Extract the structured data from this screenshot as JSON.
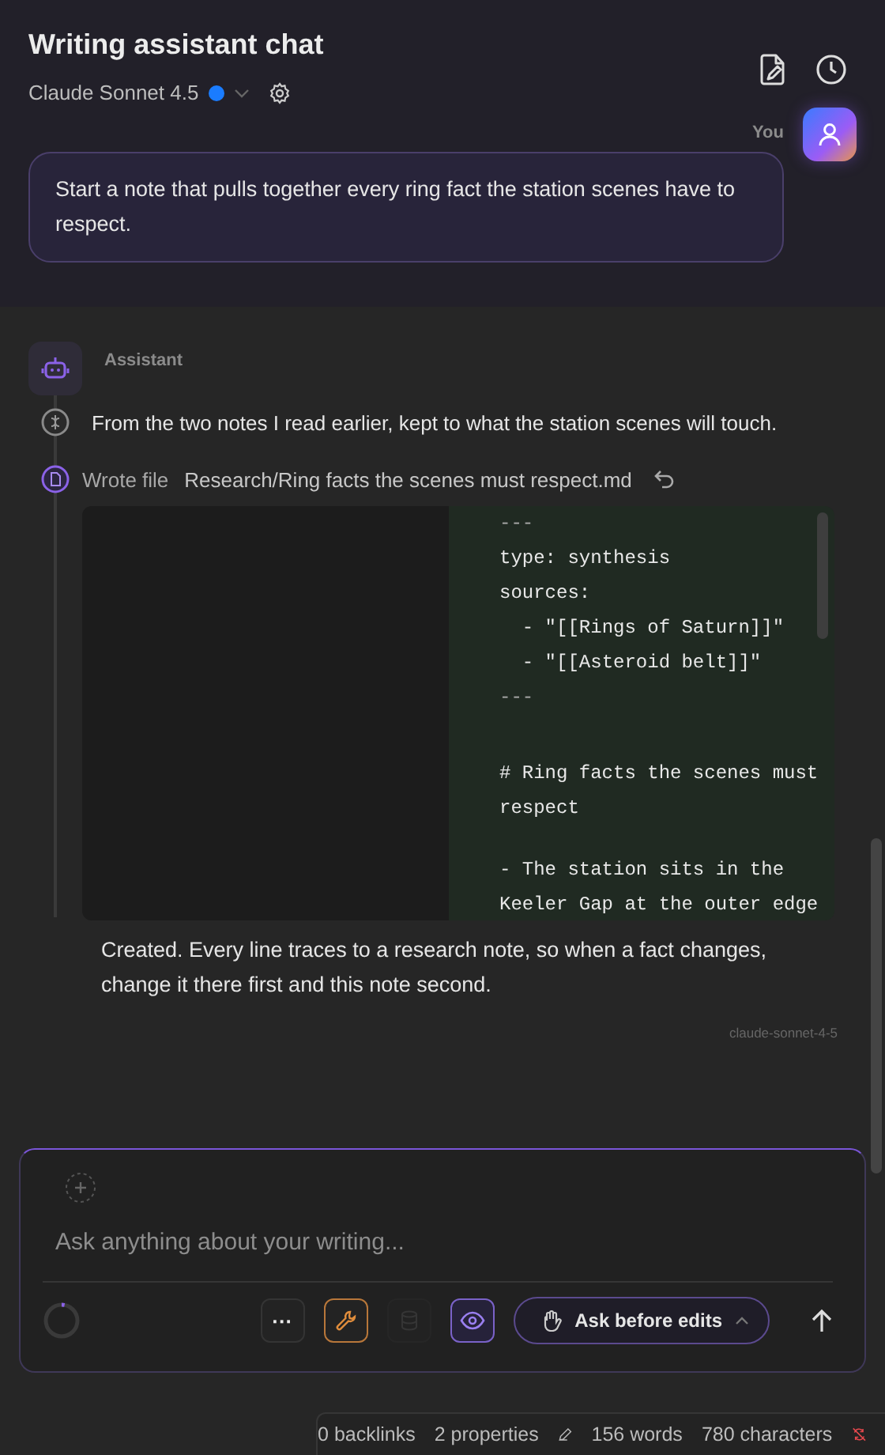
{
  "header": {
    "title": "Writing assistant chat",
    "model": "Claude Sonnet 4.5"
  },
  "user_message": {
    "author": "You",
    "text": "Start a note that pulls together every ring fact the station scenes have to respect."
  },
  "assistant": {
    "author": "Assistant",
    "steps": [
      {
        "kind": "thought",
        "text": "From the two notes I read earlier, kept to what the station scenes will touch."
      },
      {
        "kind": "file",
        "action": "Wrote file",
        "path": "Research/Ring facts the scenes must respect.md"
      }
    ],
    "code_lines": [
      {
        "kind": "fence",
        "text": "---"
      },
      {
        "kind": "yaml",
        "text": "type: synthesis"
      },
      {
        "kind": "yaml",
        "text": "sources:"
      },
      {
        "kind": "yaml",
        "text": "  - \"[[Rings of Saturn]]\""
      },
      {
        "kind": "yaml",
        "text": "  - \"[[Asteroid belt]]\""
      },
      {
        "kind": "fence",
        "text": "---"
      },
      {
        "kind": "heading",
        "text": "# Ring facts the scenes must respect"
      },
      {
        "kind": "bullet",
        "text": "- The station sits in the Keeler Gap at the outer edge"
      }
    ],
    "reply": "Created. Every line traces to a research note, so when a fact changes, change it there first and this note second.",
    "model_tag": "claude-sonnet-4-5"
  },
  "composer": {
    "placeholder": "Ask anything about your writing...",
    "context": {
      "level": 0.03
    },
    "tools": [
      {
        "kind": "more",
        "text": "···",
        "on": false,
        "disabled": false
      },
      {
        "kind": "wrench",
        "on": true,
        "disabled": false
      },
      {
        "kind": "database",
        "on": false,
        "disabled": true
      },
      {
        "kind": "eye",
        "on": true,
        "disabled": false
      }
    ],
    "mode": "Ask before edits"
  },
  "status_bar": {
    "backlinks": "0 backlinks",
    "properties": "2 properties",
    "words": "156 words",
    "characters": "780 characters",
    "sync_off": true
  }
}
